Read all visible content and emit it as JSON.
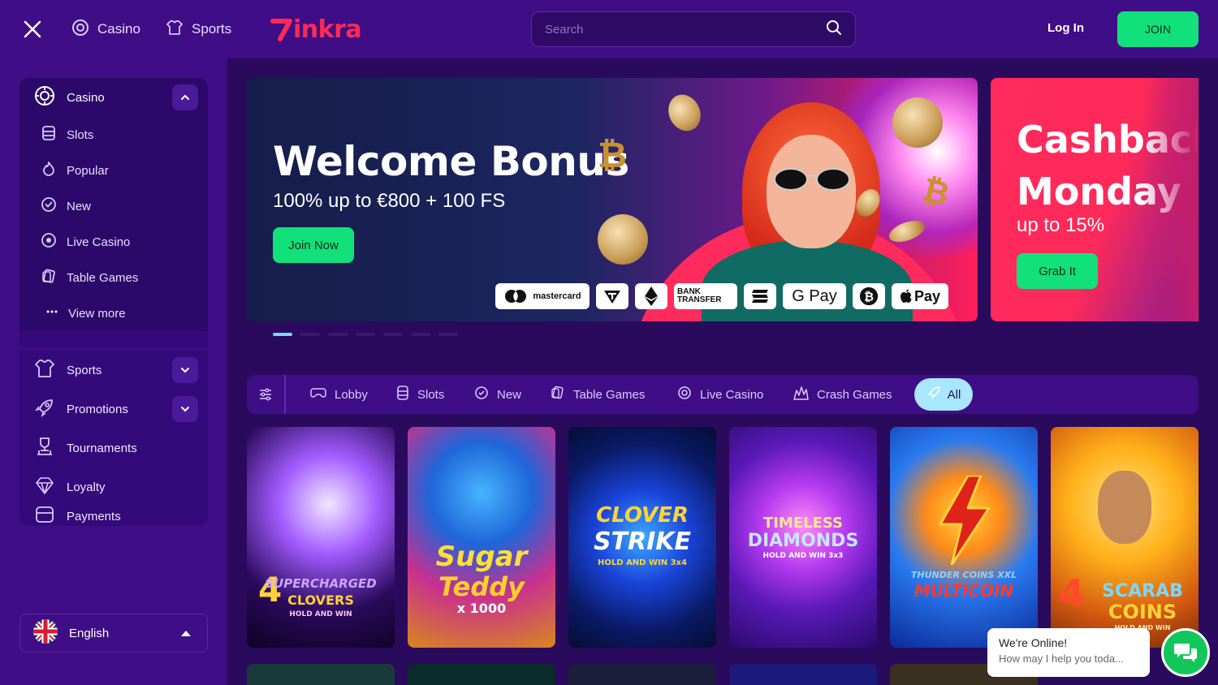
{
  "topbar": {
    "nav": [
      {
        "label": "Casino",
        "icon": "casino-chip-icon"
      },
      {
        "label": "Sports",
        "icon": "jersey-icon"
      }
    ],
    "logo": "inkra",
    "search_placeholder": "Search",
    "login_label": "Log In",
    "join_label": "JOIN"
  },
  "sidebar": {
    "casino": {
      "label": "Casino",
      "items": [
        {
          "label": "Slots",
          "icon": "slots-icon"
        },
        {
          "label": "Popular",
          "icon": "flame-icon"
        },
        {
          "label": "New",
          "icon": "badge-check-icon"
        },
        {
          "label": "Live Casino",
          "icon": "live-chip-icon"
        },
        {
          "label": "Table Games",
          "icon": "cards-icon"
        },
        {
          "label": "View more",
          "icon": "ellipsis-icon"
        }
      ]
    },
    "sections": [
      {
        "label": "Sports",
        "icon": "jersey-icon",
        "expandable": true
      },
      {
        "label": "Promotions",
        "icon": "rocket-icon",
        "expandable": true
      },
      {
        "label": "Tournaments",
        "icon": "trophy-icon",
        "expandable": false
      },
      {
        "label": "Loyalty",
        "icon": "diamond-icon",
        "expandable": false
      },
      {
        "label": "Payments",
        "icon": "wallet-icon",
        "expandable": false
      }
    ],
    "language": "English"
  },
  "hero": {
    "title": "Welcome Bonus",
    "subtitle": "100% up to €800 + 100 FS",
    "cta": "Join Now",
    "payments": [
      "mastercard",
      "BANK TRANSFER",
      "G Pay",
      "Pay"
    ]
  },
  "promo2": {
    "title_line1": "Cashback",
    "title_line2": "Monday",
    "subtitle": "up to 15%",
    "cta": "Grab It"
  },
  "carousel": {
    "count": 7,
    "active": 0
  },
  "categories": [
    {
      "label": "Lobby",
      "icon": "gamepad-icon"
    },
    {
      "label": "Slots",
      "icon": "slots-icon"
    },
    {
      "label": "New",
      "icon": "badge-check-icon"
    },
    {
      "label": "Table Games",
      "icon": "cards-icon"
    },
    {
      "label": "Live Casino",
      "icon": "live-chip-icon"
    },
    {
      "label": "Crash Games",
      "icon": "crash-icon"
    },
    {
      "label": "All",
      "icon": "rocket-icon",
      "active": true
    }
  ],
  "games": [
    {
      "name": "4 Supercharged Clovers",
      "l1": "SUPERCHARGED",
      "l2": "CLOVERS",
      "l3": "HOLD AND WIN"
    },
    {
      "name": "Sugar Teddy x1000",
      "l1": "Sugar",
      "l2": "Teddy",
      "l3": "x 1000"
    },
    {
      "name": "Clover Strike",
      "l1": "CLOVER",
      "l2": "STRIKE",
      "l3": "HOLD AND WIN 3x4"
    },
    {
      "name": "Timeless Diamonds",
      "l1": "TIMELESS",
      "l2": "DIAMONDS",
      "l3": "HOLD AND WIN 3x3"
    },
    {
      "name": "Thunder Coins XXL Multicoin",
      "l1": "THUNDER COINS XXL",
      "l2": "MULTICOIN",
      "l3": ""
    },
    {
      "name": "4 Scarab Coins",
      "l1": "SCARAB",
      "l2": "COINS",
      "l3": "HOLD AND WIN"
    }
  ],
  "chat": {
    "title": "We're Online!",
    "message": "How may I help you toda..."
  }
}
